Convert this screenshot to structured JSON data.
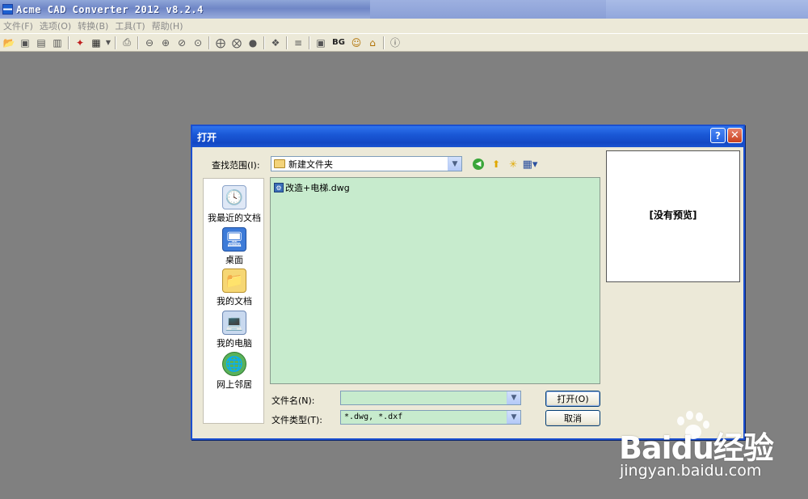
{
  "app": {
    "title": "Acme CAD Converter 2012 v8.2.4",
    "accent": "#1b4fcf"
  },
  "menu": [
    "文件(F)",
    "选项(O)",
    "转换(B)",
    "工具(T)",
    "帮助(H)"
  ],
  "toolbar": {
    "icons": [
      "open-icon",
      "save-icon",
      "save-all-icon",
      "export-icon",
      "convert-icon",
      "batch-icon",
      "print-icon",
      "zoom-out-icon",
      "zoom-in-icon",
      "zoom-window-icon",
      "zoom-fit-icon",
      "zoom-realtime-icon",
      "find-icon",
      "pan-icon",
      "layer-icon",
      "layout-icon",
      "frame-icon",
      "background-icon",
      "user-icon",
      "home-icon",
      "about-icon"
    ],
    "bg_label": "BG"
  },
  "dialog": {
    "title": "打开",
    "help_glyph": "?",
    "close_glyph": "✕",
    "look_in_label": "查找范围(I):",
    "look_in_value": "新建文件夹",
    "places": [
      {
        "label": "我最近的文档",
        "glyph": "🕓"
      },
      {
        "label": "桌面",
        "glyph": "🖥"
      },
      {
        "label": "我的文档",
        "glyph": "📁"
      },
      {
        "label": "我的电脑",
        "glyph": "💻"
      },
      {
        "label": "网上邻居",
        "glyph": "🌐"
      }
    ],
    "files": [
      {
        "name": "改造+电梯.dwg"
      }
    ],
    "preview_text": "[没有预览]",
    "file_name_label": "文件名(N):",
    "file_name_value": "",
    "file_type_label": "文件类型(T):",
    "file_type_value": "*.dwg, *.dxf",
    "open_button": "打开(O)",
    "cancel_button": "取消"
  },
  "watermark": {
    "brand": "Baidu经验",
    "url": "jingyan.baidu.com"
  }
}
